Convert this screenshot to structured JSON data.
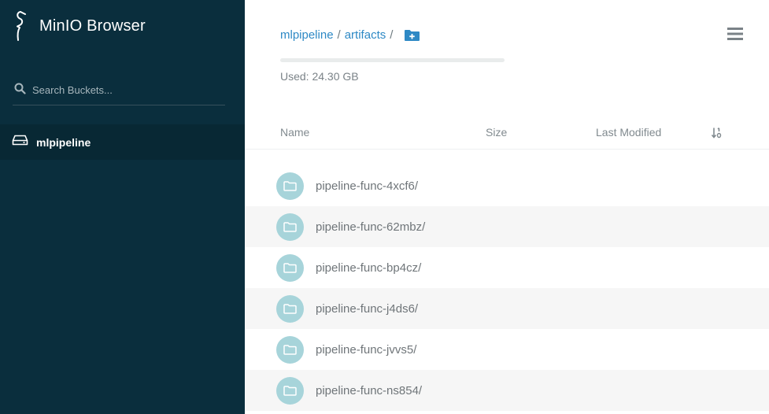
{
  "app": {
    "title": "MinIO Browser"
  },
  "sidebar": {
    "search_placeholder": "Search Buckets...",
    "buckets": [
      {
        "label": "mlpipeline",
        "selected": true
      }
    ]
  },
  "breadcrumb": {
    "items": [
      "mlpipeline",
      "artifacts"
    ],
    "separator": "/"
  },
  "usage": {
    "text": "Used: 24.30 GB",
    "fraction": 0
  },
  "table": {
    "columns": [
      "Name",
      "Size",
      "Last Modified"
    ],
    "rows": [
      {
        "name": "pipeline-func-4xcf6/"
      },
      {
        "name": "pipeline-func-62mbz/"
      },
      {
        "name": "pipeline-func-bp4cz/"
      },
      {
        "name": "pipeline-func-j4ds6/"
      },
      {
        "name": "pipeline-func-jvvs5/"
      },
      {
        "name": "pipeline-func-ns854/"
      }
    ]
  },
  "colors": {
    "sidebar_bg": "#0a2e3d",
    "accent": "#2e89c5",
    "folder_icon_bg": "#a7d4da"
  },
  "icons": {
    "logo": "minio-bird-icon",
    "search": "search-icon",
    "bucket": "drive-icon",
    "new_folder": "folder-plus-icon",
    "menu": "hamburger-menu-icon",
    "sort": "sort-icon",
    "folder": "folder-icon"
  }
}
